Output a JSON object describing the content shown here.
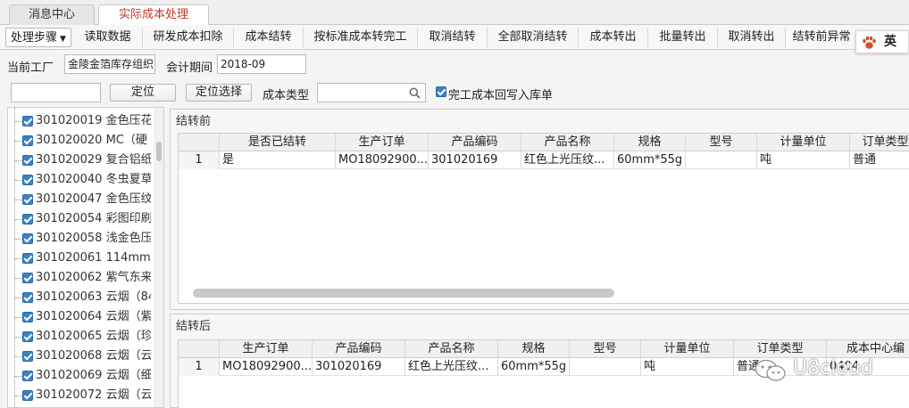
{
  "tabs": [
    {
      "label": "消息中心"
    },
    {
      "label": "实际成本处理"
    }
  ],
  "toolbar": {
    "steps": "处理步骤",
    "read": "读取数据",
    "rd_deduct": "研发成本扣除",
    "carry": "成本结转",
    "std_transfer": "按标准成本转完工",
    "cancel_carry": "取消结转",
    "cancel_all": "全部取消结转",
    "transfer_out": "成本转出",
    "batch_out": "批量转出",
    "cancel_out": "取消转出",
    "pre_abnormal": "结转前异常"
  },
  "ime": {
    "label": "英"
  },
  "filter": {
    "plant_label": "当前工厂",
    "plant_value": "金陵金箔库存组织",
    "period_label": "会计期间",
    "period_value": "2018-09",
    "locate_value": "",
    "locate_btn": "定位",
    "locate_select_btn": "定位选择",
    "cost_type_label": "成本类型",
    "cost_type_value": "",
    "writeback_label": "完工成本回写入库单"
  },
  "tree": {
    "items": [
      "301020019 金色压花",
      "301020020 MC（硬",
      "301020029 复合铝纸",
      "301020040 冬虫夏草",
      "301020047 金色压纹",
      "301020054 彩图印刷",
      "301020058 浅金色压",
      "301020061 114mm;",
      "301020062 紫气东来",
      "301020063 云烟（84",
      "301020064 云烟（紫",
      "301020065 云烟（珍",
      "301020068 云烟（云",
      "301020069 云烟（细",
      "301020072 云烟（云"
    ]
  },
  "before": {
    "title": "结转前",
    "headers": [
      "",
      "是否已结转",
      "生产订单",
      "产品编码",
      "产品名称",
      "规格",
      "型号",
      "计量单位",
      "订单类型"
    ],
    "rows": [
      [
        "1",
        "是",
        "MO18092900...",
        "301020169",
        "红色上光压纹...",
        "60mm*55g",
        "",
        "吨",
        "普通"
      ]
    ]
  },
  "after": {
    "title": "结转后",
    "headers": [
      "",
      "生产订单",
      "产品编码",
      "产品名称",
      "规格",
      "型号",
      "计量单位",
      "订单类型",
      "成本中心编"
    ],
    "rows": [
      [
        "1",
        "MO18092900...",
        "301020169",
        "红色上光压纹...",
        "60mm*55g",
        "",
        "吨",
        "普通",
        "0404"
      ]
    ]
  },
  "watermark": {
    "text": "U8cloud"
  },
  "colors": {
    "accent": "#c0392b",
    "check": "#3b82c4"
  }
}
